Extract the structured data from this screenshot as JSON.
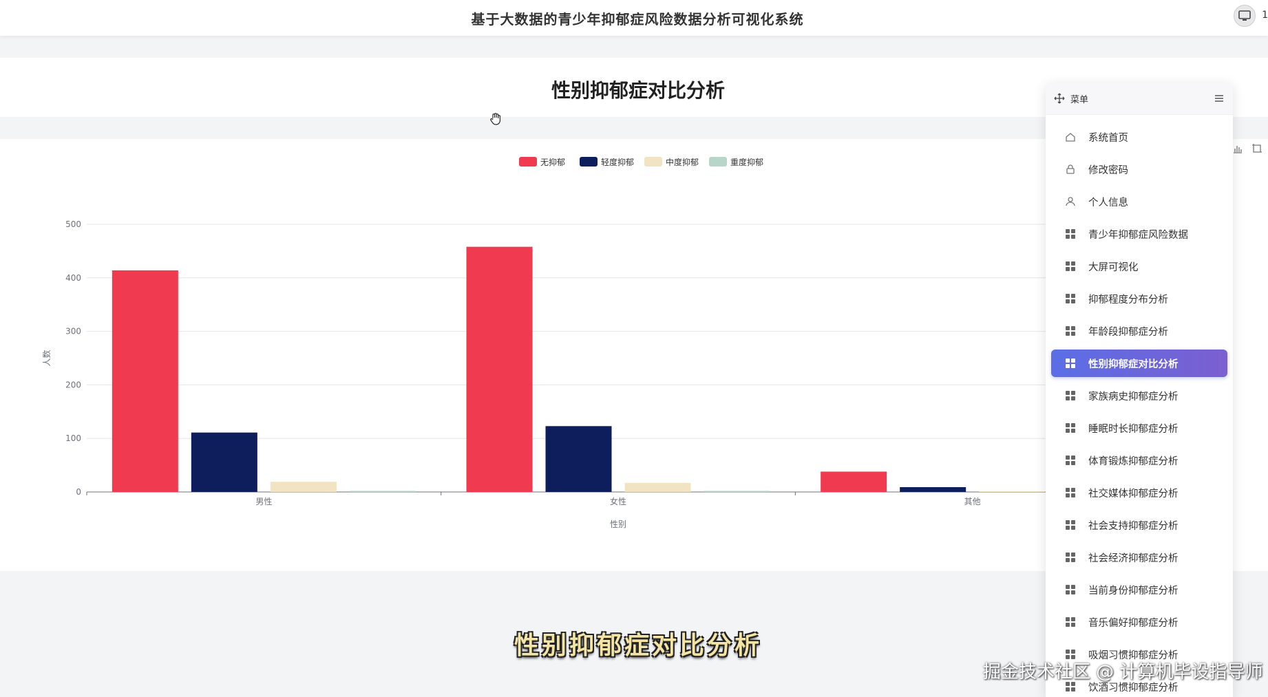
{
  "header": {
    "app_title": "基于大数据的青少年抑郁症风险数据分析可视化系统",
    "user_suffix": "1"
  },
  "page": {
    "title": "性别抑郁症对比分析"
  },
  "chart_data": {
    "type": "bar",
    "xlabel": "性别",
    "ylabel": "人数",
    "ylim": [
      0,
      500
    ],
    "yticks": [
      0,
      100,
      200,
      300,
      400,
      500
    ],
    "categories": [
      "男性",
      "女性",
      "其他"
    ],
    "legend_position": "top-center",
    "grid": true,
    "series": [
      {
        "name": "无抑郁",
        "color": "#ef3a50",
        "values": [
          414,
          458,
          38
        ]
      },
      {
        "name": "轻度抑郁",
        "color": "#0e1e5c",
        "values": [
          111,
          123,
          9
        ]
      },
      {
        "name": "中度抑郁",
        "color": "#f2e4c2",
        "values": [
          19,
          17,
          1
        ]
      },
      {
        "name": "重度抑郁",
        "color": "#b9d4c8",
        "values": [
          2,
          2,
          0
        ]
      }
    ]
  },
  "menu": {
    "title": "菜单",
    "items": [
      {
        "label": "系统首页",
        "icon": "home-icon"
      },
      {
        "label": "修改密码",
        "icon": "lock-icon"
      },
      {
        "label": "个人信息",
        "icon": "user-icon"
      },
      {
        "label": "青少年抑郁症风险数据",
        "icon": "grid-icon"
      },
      {
        "label": "大屏可视化",
        "icon": "grid-icon"
      },
      {
        "label": "抑郁程度分布分析",
        "icon": "grid-icon"
      },
      {
        "label": "年龄段抑郁症分析",
        "icon": "grid-icon"
      },
      {
        "label": "性别抑郁症对比分析",
        "icon": "grid-icon",
        "active": true
      },
      {
        "label": "家族病史抑郁症分析",
        "icon": "grid-icon"
      },
      {
        "label": "睡眠时长抑郁症分析",
        "icon": "grid-icon"
      },
      {
        "label": "体育锻炼抑郁症分析",
        "icon": "grid-icon"
      },
      {
        "label": "社交媒体抑郁症分析",
        "icon": "grid-icon"
      },
      {
        "label": "社会支持抑郁症分析",
        "icon": "grid-icon"
      },
      {
        "label": "社会经济抑郁症分析",
        "icon": "grid-icon"
      },
      {
        "label": "当前身份抑郁症分析",
        "icon": "grid-icon"
      },
      {
        "label": "音乐偏好抑郁症分析",
        "icon": "grid-icon"
      },
      {
        "label": "吸烟习惯抑郁症分析",
        "icon": "grid-icon"
      },
      {
        "label": "饮酒习惯抑郁症分析",
        "icon": "grid-icon"
      }
    ]
  },
  "overlay": {
    "caption": "性别抑郁症对比分析",
    "watermark": "掘金技术社区 @ 计算机毕设指导师"
  },
  "colors": {
    "accent": "#6366e0",
    "active_gradient_start": "#5b6ee6",
    "active_gradient_end": "#7b5fd0"
  }
}
